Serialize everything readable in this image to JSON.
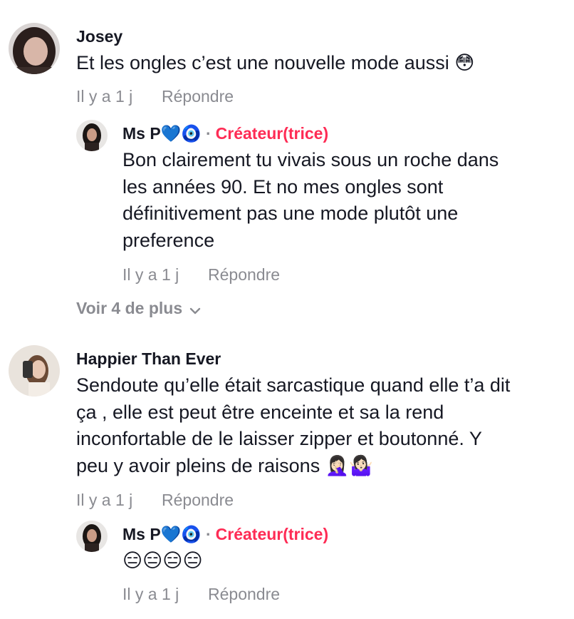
{
  "comments": [
    {
      "username": "Josey",
      "text": "Et les ongles c’est une nouvelle mode aussi 😳",
      "time": "Il y a 1 j",
      "reply_label": "Répondre",
      "replies": [
        {
          "username": "Ms P💙🧿",
          "separator": "·",
          "badge": "Créateur(trice)",
          "text": "Bon clairement tu vivais sous un roche dans\nles années 90. Et no mes ongles sont\ndéfinitivement pas une mode plutôt une\npreference",
          "time": "Il y a 1 j",
          "reply_label": "Répondre"
        }
      ],
      "more_label": "Voir 4 de plus"
    },
    {
      "username": "Happier Than Ever",
      "text": "Sendoute qu’elle était sarcastique quand elle t’a dit\nça , elle est peut être enceinte et sa la rend\ninconfortable de le laisser zipper et boutonné. Y\npeu y avoir pleins de raisons 🤦🏻‍♀️🤷🏻‍♀️",
      "time": "Il y a 1 j",
      "reply_label": "Répondre",
      "replies": [
        {
          "username": "Ms P💙🧿",
          "separator": "·",
          "badge": "Créateur(trice)",
          "text": "😑😑😑😑",
          "time": "Il y a 1 j",
          "reply_label": "Répondre"
        }
      ]
    }
  ],
  "colors": {
    "text": "#161823",
    "muted": "#8a8b91",
    "creator": "#fe2c55",
    "background": "#ffffff"
  },
  "icons": {
    "more_chevron": "chevron-down-icon"
  }
}
